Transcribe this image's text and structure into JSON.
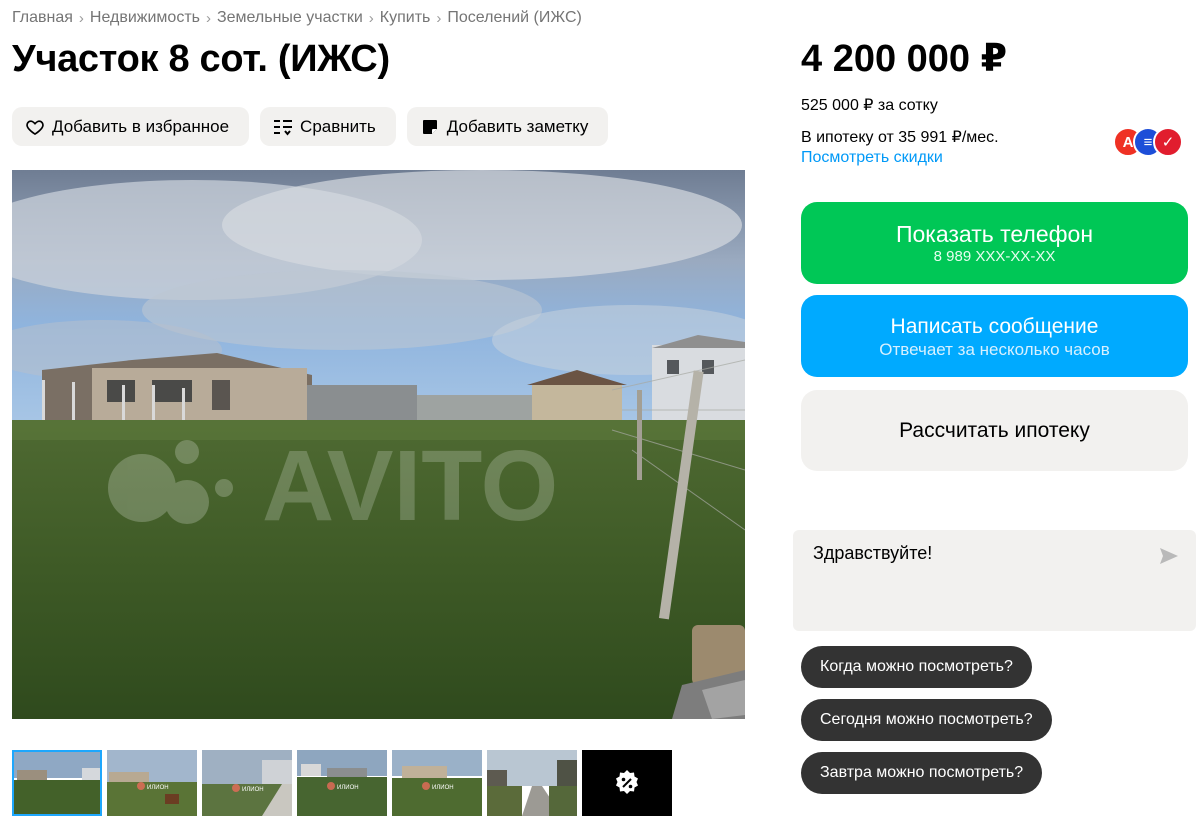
{
  "breadcrumb": [
    "Главная",
    "Недвижимость",
    "Земельные участки",
    "Купить",
    "Поселений (ИЖС)"
  ],
  "title": "Участок 8 сот. (ИЖС)",
  "actions": {
    "favorite": "Добавить в избранное",
    "compare": "Сравнить",
    "note": "Добавить заметку"
  },
  "gallery": {
    "watermark": "AVITO",
    "thumbnail_count": 6,
    "thumb_watermark": "ИЛИОН"
  },
  "price": {
    "value": "4 200 000 ₽",
    "per_sotka": "525 000 ₽ за сотку",
    "mortgage": "В ипотеку от 35 991 ₽/мес.",
    "discounts_link": "Посмотреть скидки"
  },
  "banks": [
    {
      "name": "alfa-bank-logo",
      "letter": "А",
      "color": "#ef3124"
    },
    {
      "name": "bank-logo-blue",
      "letter": "≡",
      "color": "#1d4ed8"
    },
    {
      "name": "bank-logo-red",
      "letter": "✓",
      "color": "#e11d2e"
    }
  ],
  "buttons": {
    "phone_label": "Показать телефон",
    "phone_number": "8 989 XXX-XX-XX",
    "message_label": "Написать сообщение",
    "message_sub": "Отвечает за несколько часов",
    "mortgage_calc": "Рассчитать ипотеку"
  },
  "chat": {
    "text": "Здравствуйте!"
  },
  "quick_questions": [
    "Когда можно посмотреть?",
    "Сегодня можно посмотреть?",
    "Завтра можно посмотреть?"
  ],
  "colors": {
    "green": "#00c756",
    "blue": "#00aaff",
    "link": "#0099f7",
    "chip": "#333333"
  }
}
